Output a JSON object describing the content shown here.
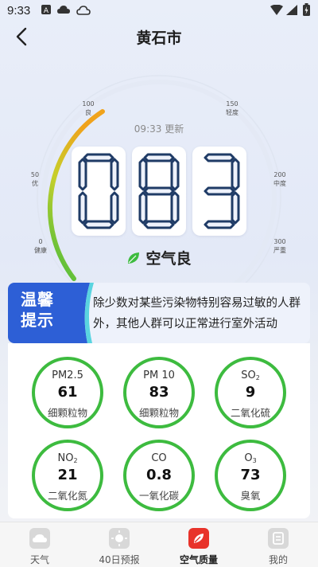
{
  "status_bar": {
    "time": "9:33"
  },
  "header": {
    "title": "黄石市"
  },
  "gauge": {
    "labels": [
      {
        "value": "0",
        "text": "健康"
      },
      {
        "value": "50",
        "text": "优"
      },
      {
        "value": "100",
        "text": "良"
      },
      {
        "value": "150",
        "text": "轻度"
      },
      {
        "value": "200",
        "text": "中度"
      },
      {
        "value": "300",
        "text": "严重"
      }
    ],
    "update_text": "09:33 更新",
    "aqi_digits": [
      "0",
      "8",
      "3"
    ],
    "quality_text": "空气良"
  },
  "tips": {
    "badge_line1": "温馨",
    "badge_line2": "提示",
    "text": "除少数对某些污染物特别容易过敏的人群外，其他人群可以正常进行室外活动"
  },
  "pollutants": [
    {
      "name": "PM2.5",
      "value": "61",
      "desc": "细颗粒物"
    },
    {
      "name": "PM 10",
      "value": "83",
      "desc": "细颗粒物"
    },
    {
      "name": "SO",
      "sub": "2",
      "value": "9",
      "desc": "二氧化硫"
    },
    {
      "name": "NO",
      "sub": "2",
      "value": "21",
      "desc": "二氧化氮"
    },
    {
      "name": "CO",
      "value": "0.8",
      "desc": "一氧化碳"
    },
    {
      "name": "O",
      "sub": "3",
      "value": "73",
      "desc": "臭氧"
    }
  ],
  "colors": {
    "accent": "#2d5fd6",
    "good": "#3dbb3f",
    "active_tab": "#e8332a"
  },
  "nav": [
    {
      "label": "天气",
      "icon": "weather-icon"
    },
    {
      "label": "40日预报",
      "icon": "forecast-icon"
    },
    {
      "label": "空气质量",
      "icon": "air-quality-icon",
      "active": true
    },
    {
      "label": "我的",
      "icon": "profile-icon"
    }
  ]
}
